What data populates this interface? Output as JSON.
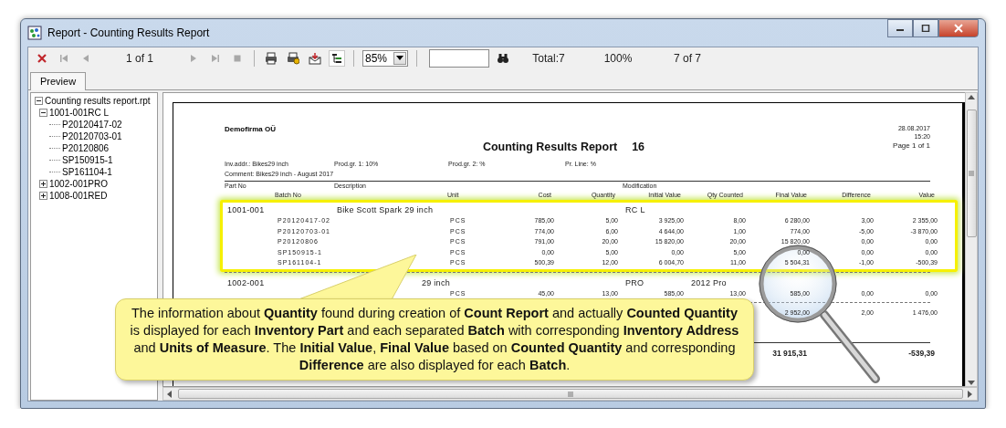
{
  "window": {
    "title": "Report - Counting Results Report"
  },
  "toolbar": {
    "items": [
      {
        "kind": "close"
      },
      {
        "kind": "first",
        "disabled": true
      },
      {
        "kind": "previous",
        "disabled": true
      },
      {
        "kind": "page",
        "text": "1 of 1"
      },
      {
        "kind": "next",
        "disabled": true
      },
      {
        "kind": "last",
        "disabled": true
      },
      {
        "kind": "stop",
        "disabled": true
      },
      {
        "kind": "separator"
      },
      {
        "kind": "print"
      },
      {
        "kind": "print_setup"
      },
      {
        "kind": "export"
      },
      {
        "kind": "group_tree",
        "pressed": true
      },
      {
        "kind": "separator"
      },
      {
        "kind": "zoom",
        "value": "85%"
      },
      {
        "kind": "separator"
      },
      {
        "kind": "search"
      },
      {
        "kind": "find"
      },
      {
        "kind": "text",
        "text": "Total:7"
      },
      {
        "kind": "text",
        "text": "100%"
      },
      {
        "kind": "text",
        "text": "7 of 7"
      }
    ]
  },
  "tabs": [
    {
      "label": "Preview",
      "selected": true
    }
  ],
  "tree": {
    "label": "Counting results report.rpt",
    "expanded": true,
    "children": [
      {
        "label": "1001-001RC L",
        "expanded": true,
        "children": [
          {
            "label": "P20120417-02"
          },
          {
            "label": "P20120703-01"
          },
          {
            "label": "P20120806"
          },
          {
            "label": "SP150915-1"
          },
          {
            "label": "SP161104-1"
          }
        ]
      },
      {
        "label": "1002-001PRO",
        "expanded": false
      },
      {
        "label": "1008-001RED",
        "expanded": false
      }
    ]
  },
  "report": {
    "company": "Demofirma OÜ",
    "title": "Counting Results Report",
    "number": "16",
    "date": "28.08.2017",
    "time": "15:20",
    "page": "Page 1 of 1",
    "filters": [
      "Inv.addr.: Bikes29 inch",
      "Prod.gr. 1: 10%",
      "Prod.gr. 2: %",
      "Pr. Line: %"
    ],
    "comment": "Comment: Bikes29 inch - August 2017",
    "header_top": {
      "part_no": "Part No",
      "description": "Description",
      "modification": "Modification"
    },
    "columns": [
      "Batch No",
      "Unit",
      "Cost",
      "Quantity",
      "Initial Value",
      "Qty Counted",
      "Final Value",
      "Difference",
      "Value"
    ],
    "groups": [
      {
        "part_no": "1001-001",
        "description": "Bike Scott Spark 29 inch",
        "modification": [
          "RC L"
        ],
        "highlighted": true,
        "batches": [
          {
            "cells": [
              "P20120417-02",
              "PCS",
              "785,00",
              "5,00",
              "3 925,00",
              "8,00",
              "6 280,00",
              "3,00",
              "2 355,00"
            ]
          },
          {
            "cells": [
              "P20120703-01",
              "PCS",
              "774,00",
              "6,00",
              "4 644,00",
              "1,00",
              "774,00",
              "-5,00",
              "-3 870,00"
            ]
          },
          {
            "cells": [
              "P20120806",
              "PCS",
              "791,00",
              "20,00",
              "15 820,00",
              "20,00",
              "15 820,00",
              "0,00",
              "0,00"
            ]
          },
          {
            "cells": [
              "SP150915-1",
              "PCS",
              "0,00",
              "5,00",
              "0,00",
              "5,00",
              "0,00",
              "0,00",
              "0,00"
            ]
          },
          {
            "cells": [
              "SP161104-1",
              "PCS",
              "500,39",
              "12,00",
              "6 004,70",
              "11,00",
              "5 504,31",
              "-1,00",
              "-500,39"
            ]
          }
        ]
      },
      {
        "part_no": "1002-001",
        "description": "29 inch",
        "modification": [
          "PRO",
          "2012 Pro"
        ],
        "highlighted": false,
        "batches": [
          {
            "cells": [
              null,
              "PCS",
              "45,00",
              "13,00",
              "585,00",
              "13,00",
              "585,00",
              "0,00",
              "0,00"
            ]
          }
        ]
      },
      {
        "highlighted": false,
        "batches": [
          {
            "cells": [
              null,
              null,
              null,
              null,
              null,
              null,
              "2 952,00",
              "2,00",
              "1 476,00"
            ]
          }
        ]
      }
    ],
    "totals": {
      "final_value": "31 915,31",
      "value": "-539,39"
    }
  },
  "callout": {
    "text": "The information about **Quantity** found during creation of **Count Report** and actually **Counted Quantity** is displayed for each **Inventory Part** and each separated **Batch** with corresponding **Inventory Address** and **Units of Measure**.  The **Initial Value**, **Final Value** based on **Counted Quantity** and corresponding **Difference** are also displayed for each **Batch**."
  }
}
